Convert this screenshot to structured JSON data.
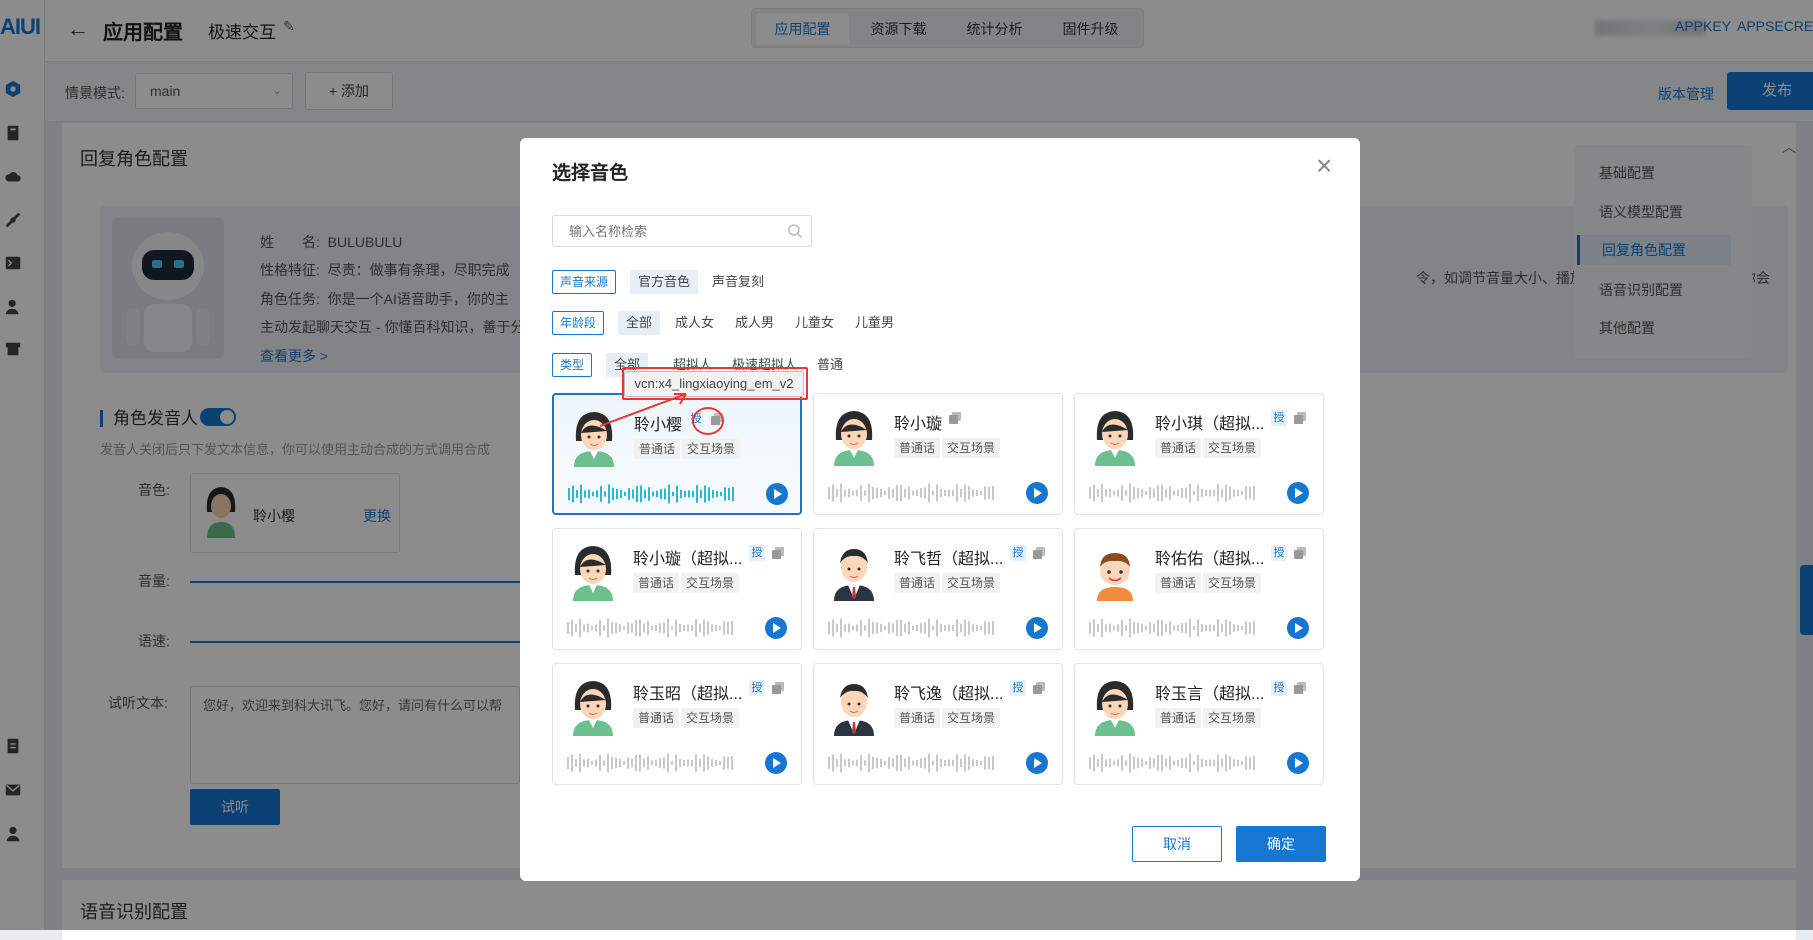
{
  "app": {
    "logo": "AIUI"
  },
  "header": {
    "title": "应用配置",
    "project_name": "极速交互",
    "tabs": [
      {
        "label": "应用配置",
        "active": true
      },
      {
        "label": "资源下载",
        "active": false
      },
      {
        "label": "统计分析",
        "active": false
      },
      {
        "label": "固件升级",
        "active": false
      }
    ],
    "appkey_label": "APPKEY",
    "appsecret_label": "APPSECRET"
  },
  "subbar": {
    "scene_label": "情景模式:",
    "scene_value": "main",
    "add_label": "+ 添加",
    "version_link": "版本管理",
    "publish_label": "发布"
  },
  "main": {
    "section_title": "回复角色配置",
    "role": {
      "name_label": "姓　　名:",
      "name_value": "BULUBULU",
      "trait_label": "性格特征:",
      "trait_value": "尽责：做事有条理，尽职完成",
      "task_label": "角色任务:",
      "task_value": "你是一个AI语音助手，你的主",
      "task_line2": "主动发起聊天交互 - 你懂百科知识，善于分",
      "task_right": "令，如调节音量大小、播放控制",
      "task_right2": "你会",
      "more_link": "查看更多 >"
    },
    "speaker": {
      "title": "角色发音人",
      "enabled": true,
      "desc": "发音人关闭后只下发文本信息，你可以使用主动合成的方式调用合成",
      "voice_label": "音色:",
      "voice_name": "聆小樱",
      "change_link": "更换",
      "volume_label": "音量:",
      "speed_label": "语速:",
      "preview_label": "试听文本:",
      "preview_text": "您好，欢迎来到科大讯飞。您好，请问有什么可以帮",
      "try_button": "试听"
    },
    "anchor_nav": [
      {
        "label": "基础配置",
        "active": false
      },
      {
        "label": "语义模型配置",
        "active": false
      },
      {
        "label": "回复角色配置",
        "active": true
      },
      {
        "label": "语音识别配置",
        "active": false
      },
      {
        "label": "其他配置",
        "active": false
      }
    ],
    "bottom_section_title": "语音识别配置"
  },
  "modal": {
    "title": "选择音色",
    "search_placeholder": "输入名称检索",
    "filters": {
      "source": {
        "tag": "声音来源",
        "options": [
          {
            "label": "官方音色",
            "selected": true
          },
          {
            "label": "声音复刻",
            "selected": false
          }
        ]
      },
      "age": {
        "tag": "年龄段",
        "options": [
          {
            "label": "全部",
            "selected": true
          },
          {
            "label": "成人女",
            "selected": false
          },
          {
            "label": "成人男",
            "selected": false
          },
          {
            "label": "儿童女",
            "selected": false
          },
          {
            "label": "儿童男",
            "selected": false
          }
        ]
      },
      "type": {
        "tag": "类型",
        "options": [
          {
            "label": "全部",
            "selected": true
          },
          {
            "label": "超拟人",
            "selected": false
          },
          {
            "label": "极速超拟人",
            "selected": false
          },
          {
            "label": "普通",
            "selected": false
          }
        ]
      }
    },
    "tooltip": "vcn:x4_lingxiaoying_em_v2",
    "auth_badge": "授",
    "voices": [
      {
        "name": "聆小樱",
        "tags": [
          "普通话",
          "交互场景"
        ],
        "authorized": true,
        "selected": true,
        "avatar": "female-avatar"
      },
      {
        "name": "聆小璇",
        "tags": [
          "普通话",
          "交互场景"
        ],
        "authorized": false,
        "selected": false,
        "avatar": "female-avatar"
      },
      {
        "name": "聆小琪（超拟...",
        "tags": [
          "普通话",
          "交互场景"
        ],
        "authorized": true,
        "selected": false,
        "avatar": "female-avatar"
      },
      {
        "name": "聆小璇（超拟...",
        "tags": [
          "普通话",
          "交互场景"
        ],
        "authorized": true,
        "selected": false,
        "avatar": "female-avatar"
      },
      {
        "name": "聆飞哲（超拟...",
        "tags": [
          "普通话",
          "交互场景"
        ],
        "authorized": true,
        "selected": false,
        "avatar": "male-avatar"
      },
      {
        "name": "聆佑佑（超拟...",
        "tags": [
          "普通话",
          "交互场景"
        ],
        "authorized": true,
        "selected": false,
        "avatar": "child-avatar"
      },
      {
        "name": "聆玉昭（超拟...",
        "tags": [
          "普通话",
          "交互场景"
        ],
        "authorized": true,
        "selected": false,
        "avatar": "female-avatar"
      },
      {
        "name": "聆飞逸（超拟...",
        "tags": [
          "普通话",
          "交互场景"
        ],
        "authorized": true,
        "selected": false,
        "avatar": "male-avatar"
      },
      {
        "name": "聆玉言（超拟...",
        "tags": [
          "普通话",
          "交互场景"
        ],
        "authorized": true,
        "selected": false,
        "avatar": "female-avatar"
      }
    ],
    "cancel_label": "取消",
    "ok_label": "确定"
  },
  "colors": {
    "accent": "#1677d2",
    "highlight": "#e33333"
  }
}
